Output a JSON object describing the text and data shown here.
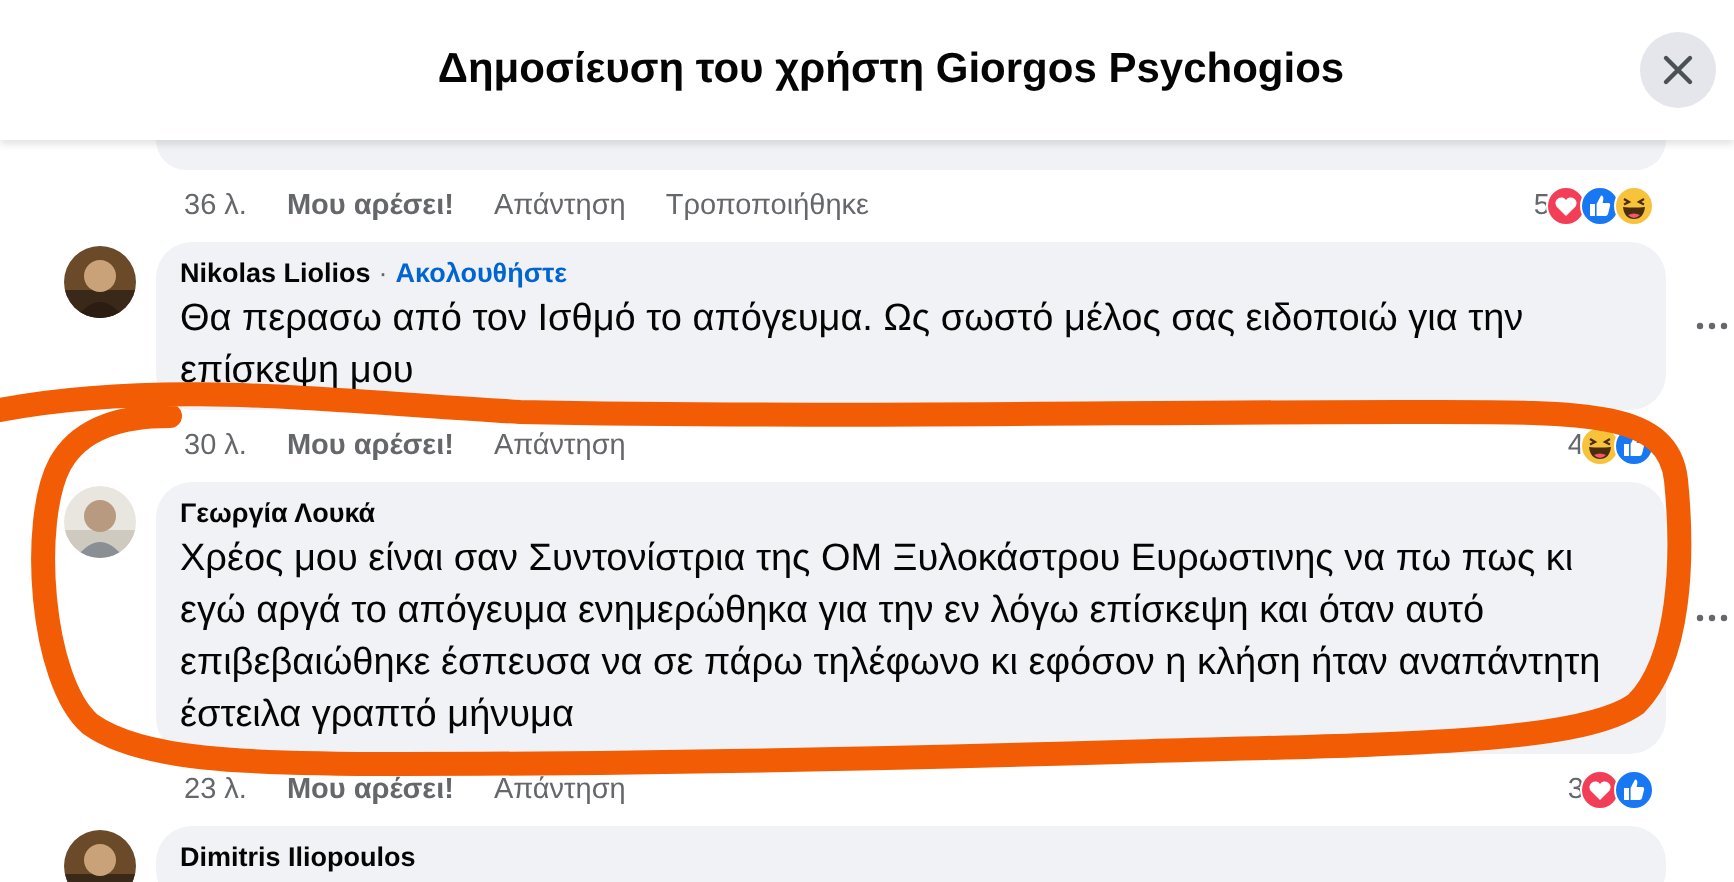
{
  "header": {
    "title": "Δημοσίευση του χρήστη Giorgos Psychogios"
  },
  "comments": [
    {
      "kind": "cut_top",
      "time": "36 λ.",
      "like": "Μου αρέσει!",
      "reply": "Απάντηση",
      "edited": "Τροποποιήθηκε",
      "reaction_count": "5",
      "reactions": [
        {
          "kind": "love"
        },
        {
          "kind": "like"
        },
        {
          "kind": "haha"
        }
      ]
    },
    {
      "kind": "full",
      "author": "Nikolas Liolios",
      "separator": "·",
      "follow": "Ακολουθήστε",
      "text": "Θα περασω από τον Ισθμό το απόγευμα. Ως σωστό μέλος σας ειδοποιώ για την επίσκεψη μου",
      "time": "30 λ.",
      "like": "Μου αρέσει!",
      "reply": "Απάντηση",
      "reaction_count": "4",
      "reactions": [
        {
          "kind": "haha"
        },
        {
          "kind": "like"
        }
      ]
    },
    {
      "kind": "full",
      "author": "Γεωργία Λουκά",
      "text": "Χρέος μου είναι σαν Συντονίστρια της ΟΜ Ξυλοκάστρου Ευρωστινης να πω πως κι εγώ αργά το απόγευμα ενημερώθηκα για την εν λόγω επίσκεψη και όταν αυτό επιβεβαιώθηκε έσπευσα να σε πάρω τηλέφωνο κι εφόσον η κλήση ήταν αναπάντητη έστειλα γραπτό μήνυμα",
      "time": "23 λ.",
      "like": "Μου αρέσει!",
      "reply": "Απάντηση",
      "reaction_count": "3",
      "reactions": [
        {
          "kind": "love"
        },
        {
          "kind": "like"
        }
      ]
    },
    {
      "kind": "cut_bottom",
      "author": "Dimitris Iliopoulos"
    }
  ]
}
